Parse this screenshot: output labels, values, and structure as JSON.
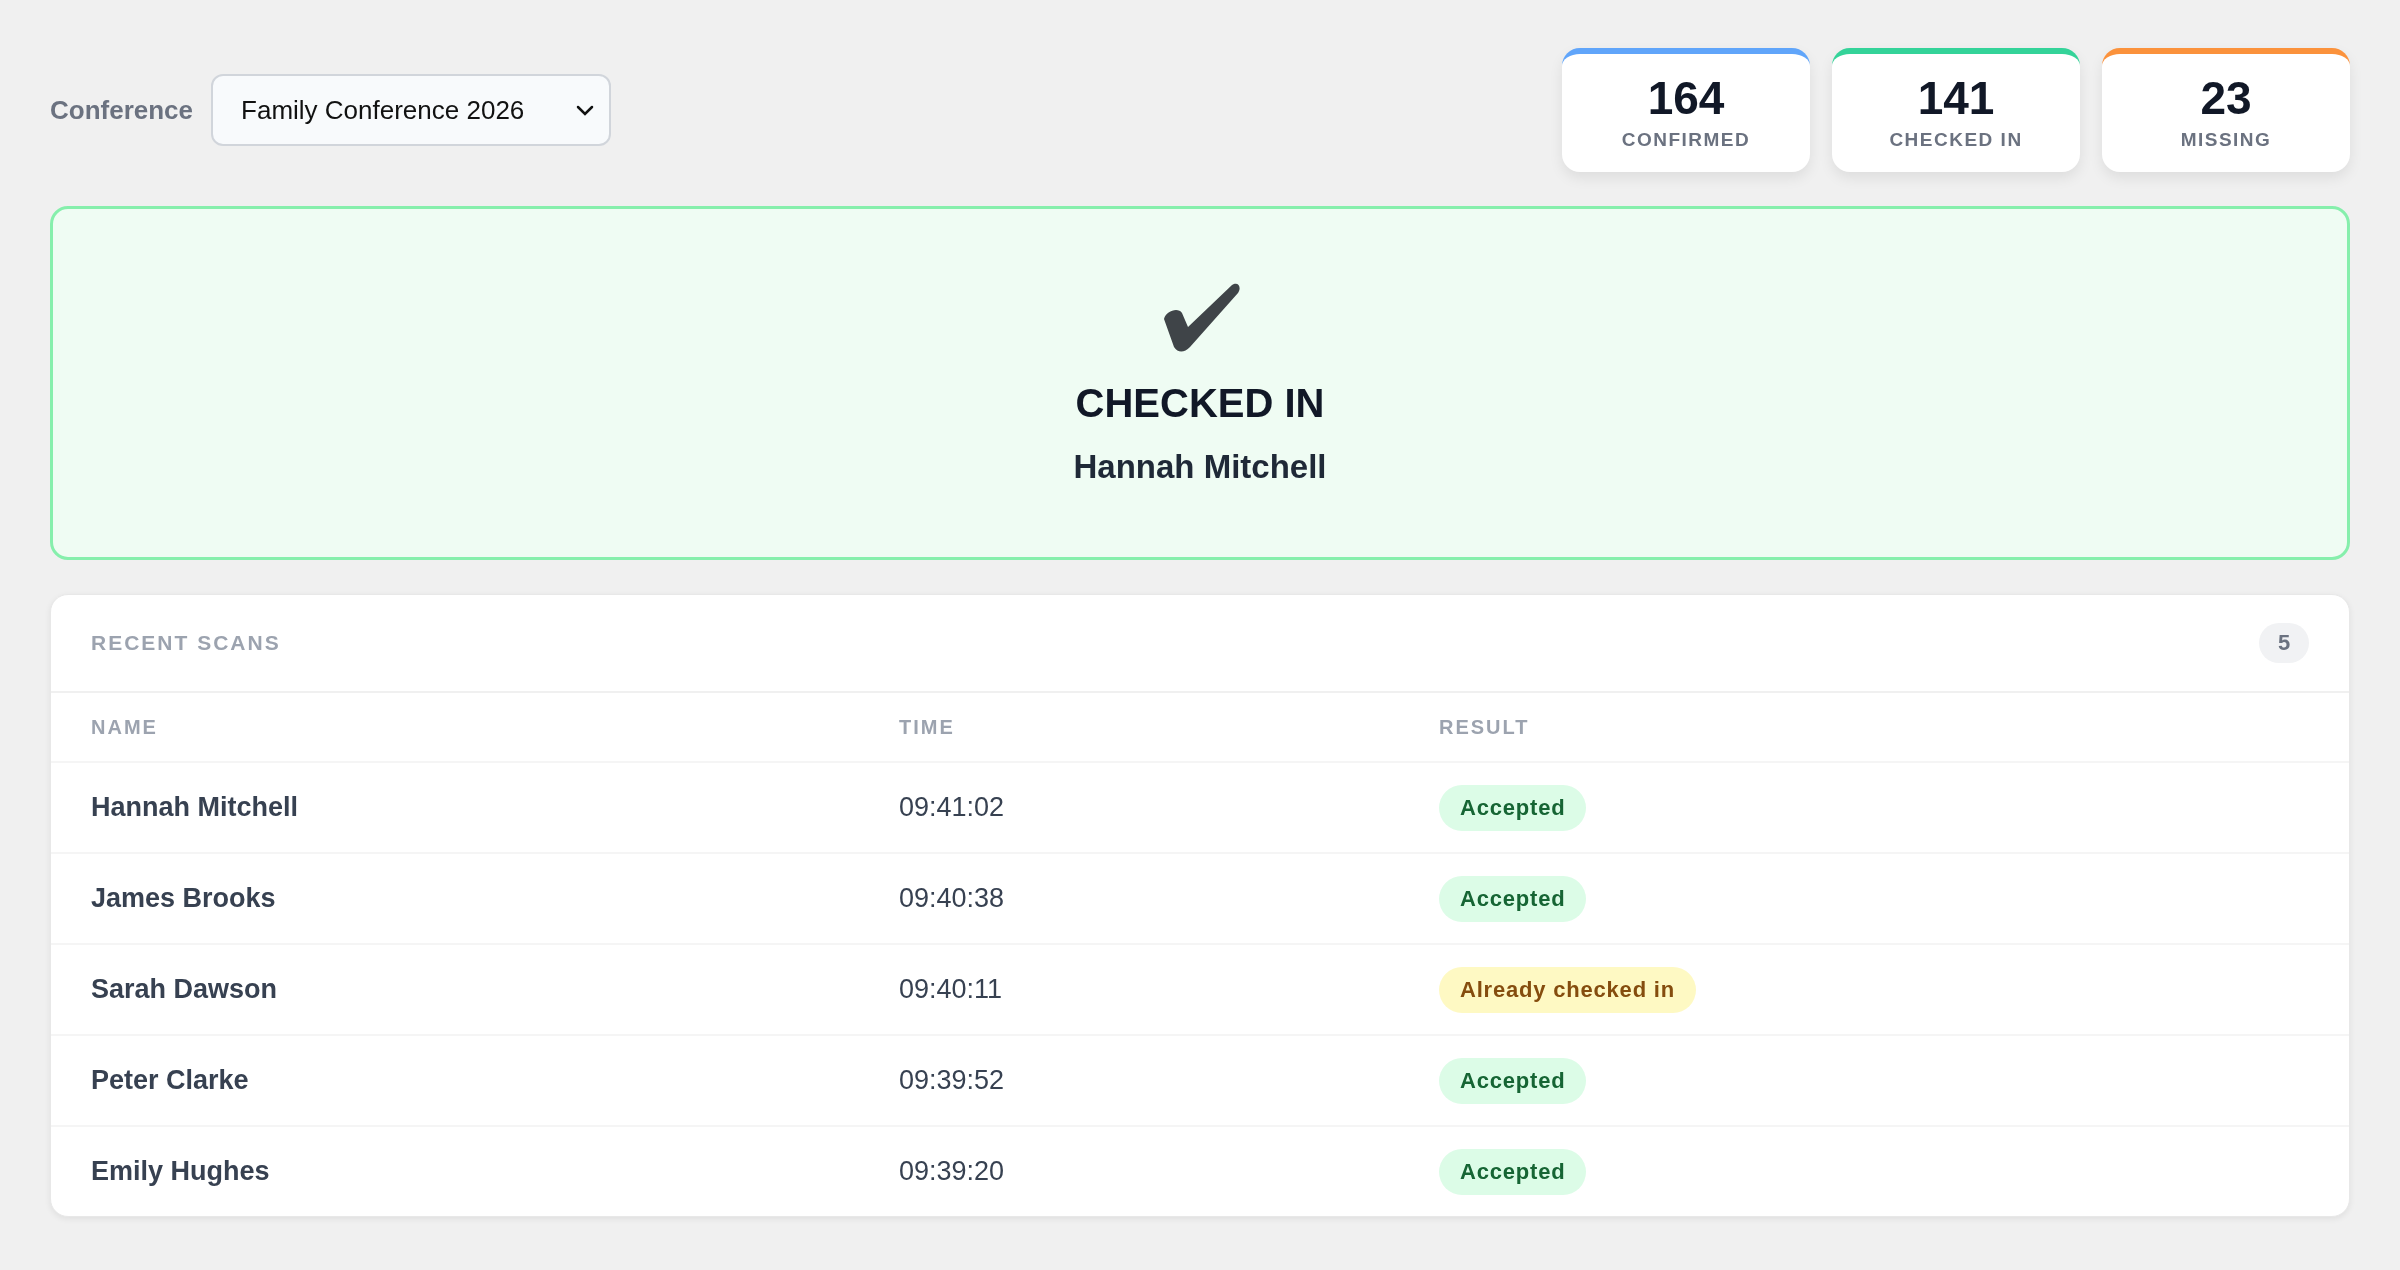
{
  "conference": {
    "label": "Conference",
    "value": "Family Conference 2026"
  },
  "stats": [
    {
      "value": "164",
      "label": "CONFIRMED",
      "color": "#60a5fa"
    },
    {
      "value": "141",
      "label": "CHECKED IN",
      "color": "#34d399"
    },
    {
      "value": "23",
      "label": "MISSING",
      "color": "#fb923c"
    }
  ],
  "result": {
    "kind": "success",
    "title": "CHECKED IN",
    "name": "Hannah Mitchell"
  },
  "recent_scans": {
    "title": "RECENT SCANS",
    "count": "5",
    "columns": [
      "NAME",
      "TIME",
      "RESULT"
    ],
    "rows": [
      {
        "name": "Hannah Mitchell",
        "time": "09:41:02",
        "result": "Accepted",
        "kind": "accepted"
      },
      {
        "name": "James Brooks",
        "time": "09:40:38",
        "result": "Accepted",
        "kind": "accepted"
      },
      {
        "name": "Sarah Dawson",
        "time": "09:40:11",
        "result": "Already checked in",
        "kind": "duplicate"
      },
      {
        "name": "Peter Clarke",
        "time": "09:39:52",
        "result": "Accepted",
        "kind": "accepted"
      },
      {
        "name": "Emily Hughes",
        "time": "09:39:20",
        "result": "Accepted",
        "kind": "accepted"
      }
    ]
  }
}
